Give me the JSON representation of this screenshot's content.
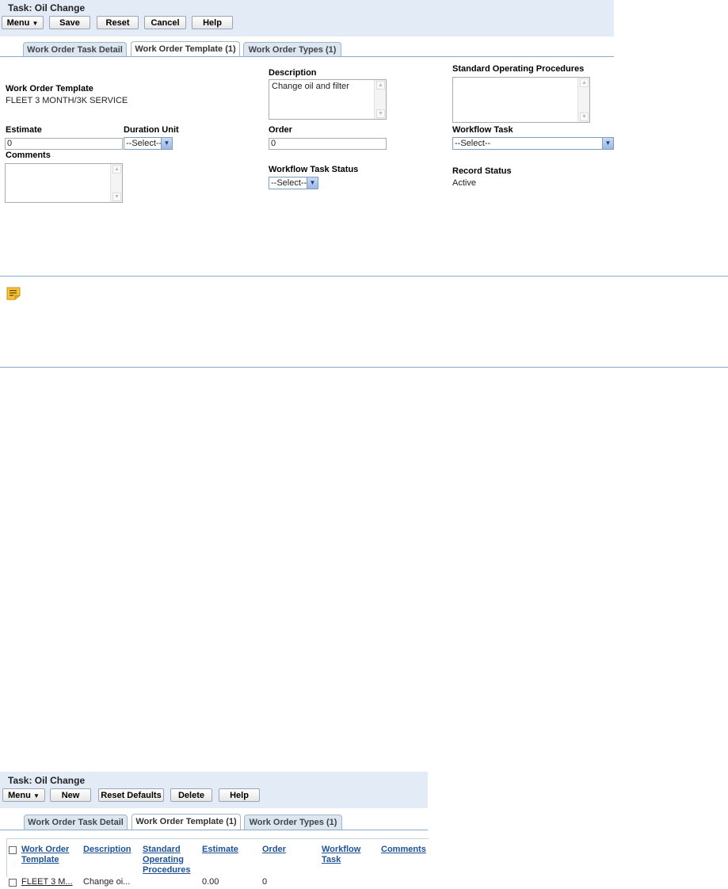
{
  "top": {
    "title": "Task: Oil Change",
    "buttons": {
      "menu": "Menu",
      "save": "Save",
      "reset": "Reset",
      "cancel": "Cancel",
      "help": "Help"
    },
    "tabs": [
      "Work Order Task Detail",
      "Work Order Template (1)",
      "Work Order Types (1)"
    ],
    "form": {
      "work_order_template_label": "Work Order Template",
      "work_order_template_value": "FLEET 3 MONTH/3K SERVICE",
      "description_label": "Description",
      "description_value": "Change oil and filter",
      "sop_label": "Standard Operating Procedures",
      "sop_value": "",
      "estimate_label": "Estimate",
      "estimate_value": "0",
      "duration_unit_label": "Duration Unit",
      "duration_unit_value": "--Select--",
      "order_label": "Order",
      "order_value": "0",
      "workflow_task_label": "Workflow Task",
      "workflow_task_value": "--Select--",
      "comments_label": "Comments",
      "comments_value": "",
      "workflow_task_status_label": "Workflow Task Status",
      "workflow_task_status_value": "--Select--",
      "record_status_label": "Record Status",
      "record_status_value": "Active"
    },
    "note_icon": "note-icon"
  },
  "bottom": {
    "title": "Task: Oil Change",
    "buttons": {
      "menu": "Menu",
      "new": "New",
      "reset_defaults": "Reset Defaults",
      "delete": "Delete",
      "help": "Help"
    },
    "tabs": [
      "Work Order Task Detail",
      "Work Order Template (1)",
      "Work Order Types (1)"
    ],
    "table": {
      "headers": {
        "work_order_template": [
          "Work Order",
          "Template"
        ],
        "description": "Description",
        "sop": [
          "Standard",
          "Operating",
          "Procedures"
        ],
        "estimate": "Estimate",
        "order": "Order",
        "workflow_task": [
          "Workflow",
          "Task"
        ],
        "comments": "Comments"
      },
      "rows": [
        {
          "work_order_template": "FLEET 3 M...",
          "description": "Change oi...",
          "sop": "",
          "estimate": "0.00",
          "order": "0",
          "workflow_task": "",
          "comments": ""
        }
      ]
    }
  },
  "colors": {
    "header_bg": "#e3ecf6",
    "link": "#1d5296",
    "rule": "#8aaac8"
  }
}
